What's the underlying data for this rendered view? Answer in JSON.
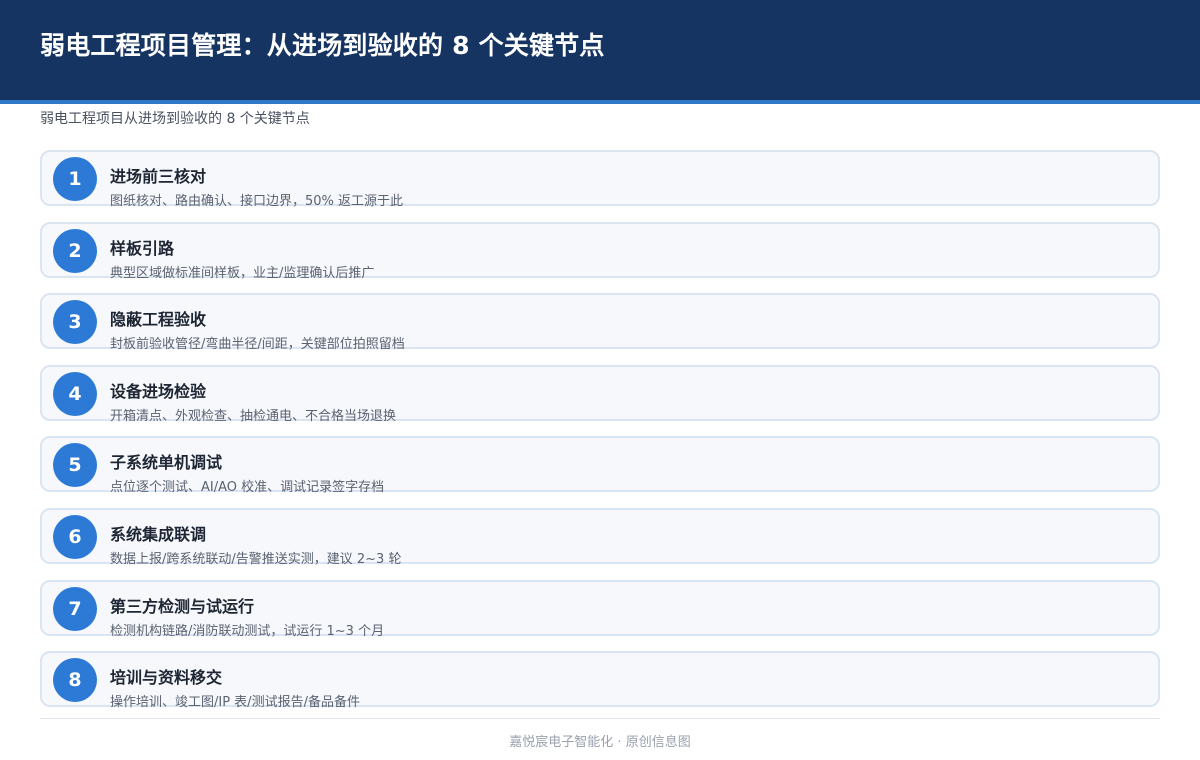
{
  "header": {
    "title": "弱电工程项目管理：从进场到验收的 8 个关键节点",
    "subtitle": "弱电工程项目从进场到验收的 8 个关键节点"
  },
  "steps": [
    {
      "number": "1",
      "title": "进场前三核对",
      "desc": "图纸核对、路由确认、接口边界，50% 返工源于此"
    },
    {
      "number": "2",
      "title": "样板引路",
      "desc": "典型区域做标准间样板，业主/监理确认后推广"
    },
    {
      "number": "3",
      "title": "隐蔽工程验收",
      "desc": "封板前验收管径/弯曲半径/间距，关键部位拍照留档"
    },
    {
      "number": "4",
      "title": "设备进场检验",
      "desc": "开箱清点、外观检查、抽检通电、不合格当场退换"
    },
    {
      "number": "5",
      "title": "子系统单机调试",
      "desc": "点位逐个测试、AI/AO 校准、调试记录签字存档"
    },
    {
      "number": "6",
      "title": "系统集成联调",
      "desc": "数据上报/跨系统联动/告警推送实测，建议 2~3 轮"
    },
    {
      "number": "7",
      "title": "第三方检测与试运行",
      "desc": "检测机构链路/消防联动测试，试运行 1~3 个月"
    },
    {
      "number": "8",
      "title": "培训与资料移交",
      "desc": "操作培训、竣工图/IP 表/测试报告/备品备件"
    }
  ],
  "footer": {
    "text": "嘉悦宸电子智能化 · 原创信息图"
  }
}
